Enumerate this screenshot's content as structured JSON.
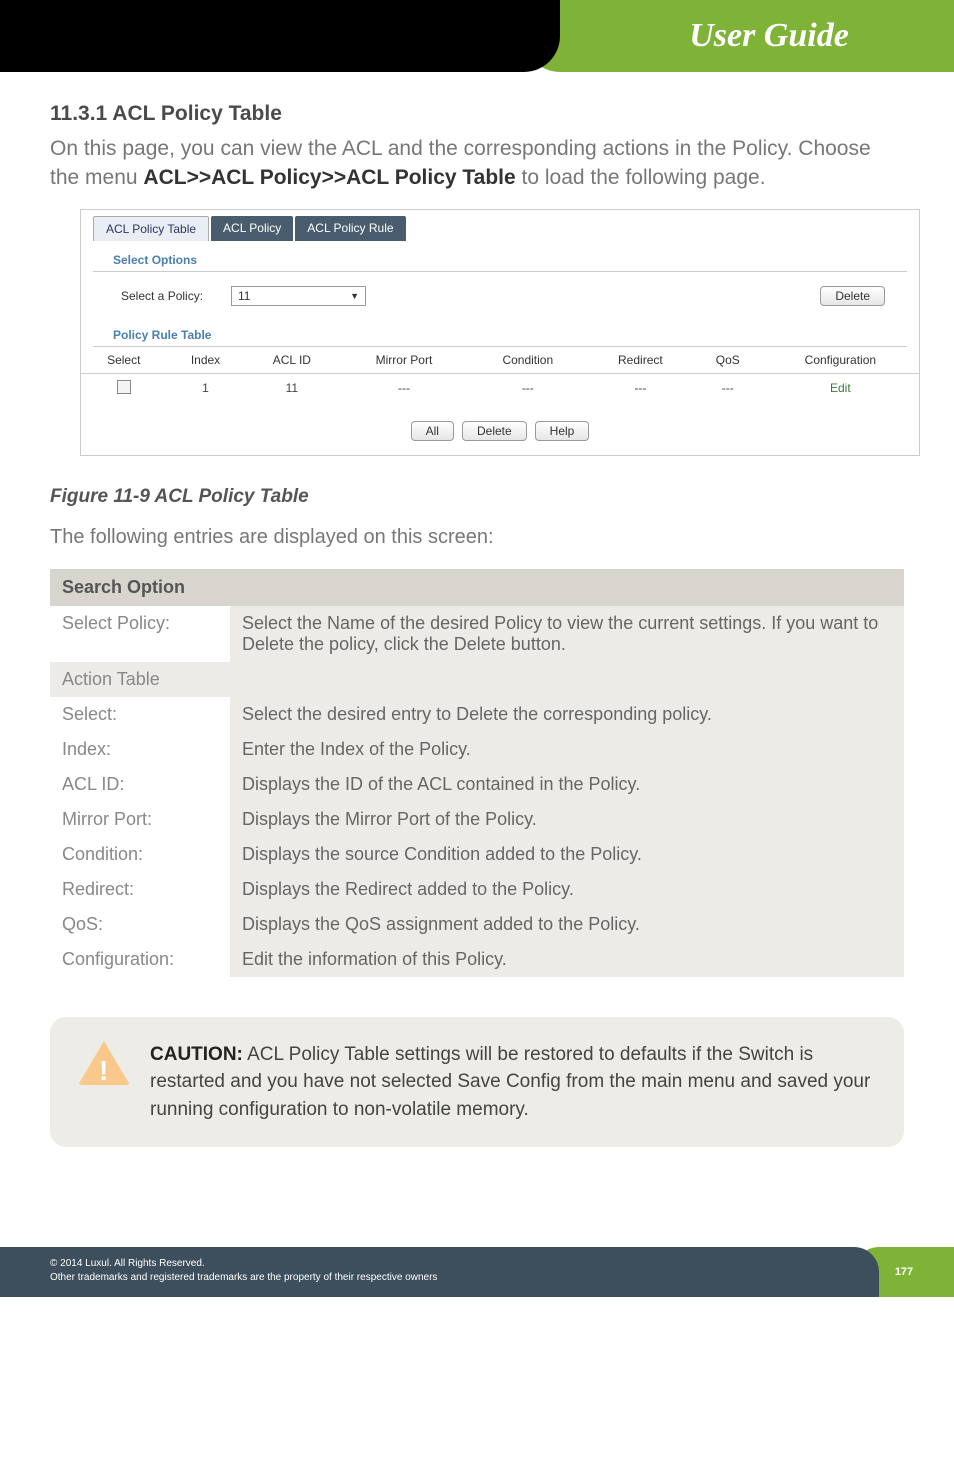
{
  "banner": {
    "title": "User Guide"
  },
  "section": {
    "heading": "11.3.1 ACL Policy Table",
    "intro_pre": "On this page, you can view the ACL and the corresponding actions in the Policy. Choose the menu ",
    "intro_bold": "ACL>>ACL Policy>>ACL Policy Table",
    "intro_post": " to load the following page."
  },
  "screenshot": {
    "tabs": [
      "ACL Policy Table",
      "ACL Policy",
      "ACL Policy Rule"
    ],
    "active_tab_index": 0,
    "select_options_label": "Select Options",
    "select_policy_label": "Select a Policy:",
    "select_policy_value": "11",
    "delete_btn": "Delete",
    "policy_rule_table_label": "Policy Rule Table",
    "columns": [
      "Select",
      "Index",
      "ACL ID",
      "Mirror Port",
      "Condition",
      "Redirect",
      "QoS",
      "Configuration"
    ],
    "rows": [
      {
        "index": "1",
        "acl_id": "11",
        "mirror_port": "---",
        "condition": "---",
        "redirect": "---",
        "qos": "---",
        "config": "Edit"
      }
    ],
    "buttons": [
      "All",
      "Delete",
      "Help"
    ]
  },
  "figure_caption": "Figure 11-9 ACL Policy Table",
  "desc_line": "The following entries are displayed on this screen:",
  "info_table": {
    "header": "Search Option",
    "rows": [
      {
        "label": "Select Policy:",
        "desc": "Select the Name of the desired Policy to view the current settings. If you want to Delete the policy, click the Delete button."
      },
      {
        "label": "Action Table",
        "desc": ""
      },
      {
        "label": "Select:",
        "desc": "Select the desired entry to Delete the corresponding policy."
      },
      {
        "label": "Index:",
        "desc": "Enter the Index of the Policy."
      },
      {
        "label": "ACL ID:",
        "desc": "Displays the ID of the ACL contained in the Policy."
      },
      {
        "label": "Mirror Port:",
        "desc": "Displays the Mirror Port of the Policy."
      },
      {
        "label": "Condition:",
        "desc": "Displays the source Condition added to the Policy."
      },
      {
        "label": "Redirect:",
        "desc": "Displays the Redirect added to the Policy."
      },
      {
        "label": "QoS:",
        "desc": "Displays the QoS assignment added to the Policy."
      },
      {
        "label": "Configuration:",
        "desc": "Edit the information of this Policy."
      }
    ]
  },
  "caution": {
    "label": "CAUTION:",
    "text": " ACL Policy Table settings will be restored to defaults if the Switch is restarted and you have not selected Save Config from the main menu and saved your running configuration to non-volatile memory."
  },
  "footer": {
    "line1": "© 2014  Luxul. All Rights Reserved.",
    "line2": "Other trademarks and registered trademarks are the property of their respective owners",
    "page": "177"
  }
}
